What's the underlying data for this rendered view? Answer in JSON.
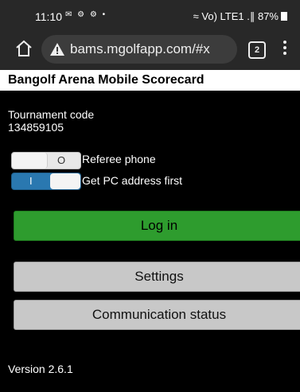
{
  "statusbar": {
    "time": "11:10",
    "icons": "✉ ⚙ ⚙ •",
    "signal": "≈ Vo) LTE1 .∥",
    "battery": "87%"
  },
  "browser": {
    "url": "bams.mgolfapp.com/#x",
    "tab_count": "2"
  },
  "app": {
    "title": "Bangolf Arena Mobile Scorecard",
    "tournament_code_label": "Tournament code",
    "tournament_code_value": "134859105",
    "toggles": [
      {
        "state_text": "O",
        "label": "Referee phone",
        "on": false
      },
      {
        "state_text": "I",
        "label": "Get PC address first",
        "on": true
      }
    ],
    "buttons": {
      "login": "Log in",
      "settings": "Settings",
      "communication": "Communication status"
    },
    "version": "Version 2.6.1"
  },
  "colors": {
    "login_button": "#2e9c2e",
    "toggle_on": "#2a78b0",
    "grey_button": "#c8c8c8"
  }
}
